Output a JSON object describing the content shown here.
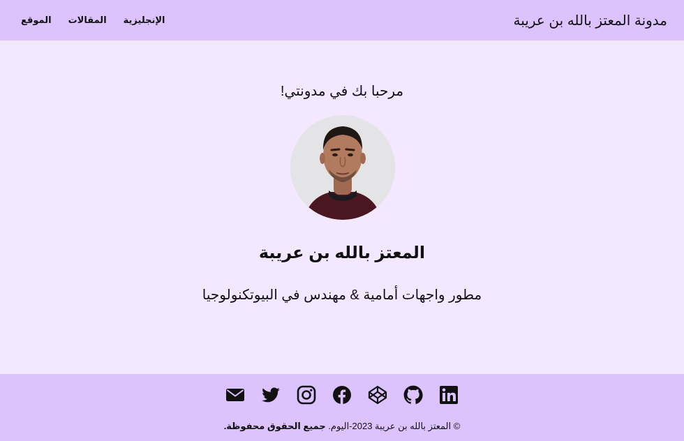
{
  "header": {
    "site_title": "مدونة المعتز بالله بن عريبة",
    "nav": [
      {
        "label": "الإنجليزية"
      },
      {
        "label": "المقالات"
      },
      {
        "label": "الموقع"
      }
    ]
  },
  "main": {
    "welcome": "مرحبا بك في مدونتي!",
    "name": "المعتز بالله بن عريبة",
    "tagline": "مطور واجهات أمامية & مهندس في البيوتكنولوجيا"
  },
  "footer": {
    "socials": [
      "email-icon",
      "twitter-icon",
      "instagram-icon",
      "facebook-icon",
      "codepen-icon",
      "github-icon",
      "linkedin-icon"
    ],
    "copyright_prefix": "© المعتز بالله بن عريبة 2023-اليوم.",
    "copyright_bold": "جميع الحقوق محفوظة."
  },
  "colors": {
    "header_bg": "#dcc3fd",
    "page_bg": "#f3e8ff",
    "text": "#111111"
  }
}
